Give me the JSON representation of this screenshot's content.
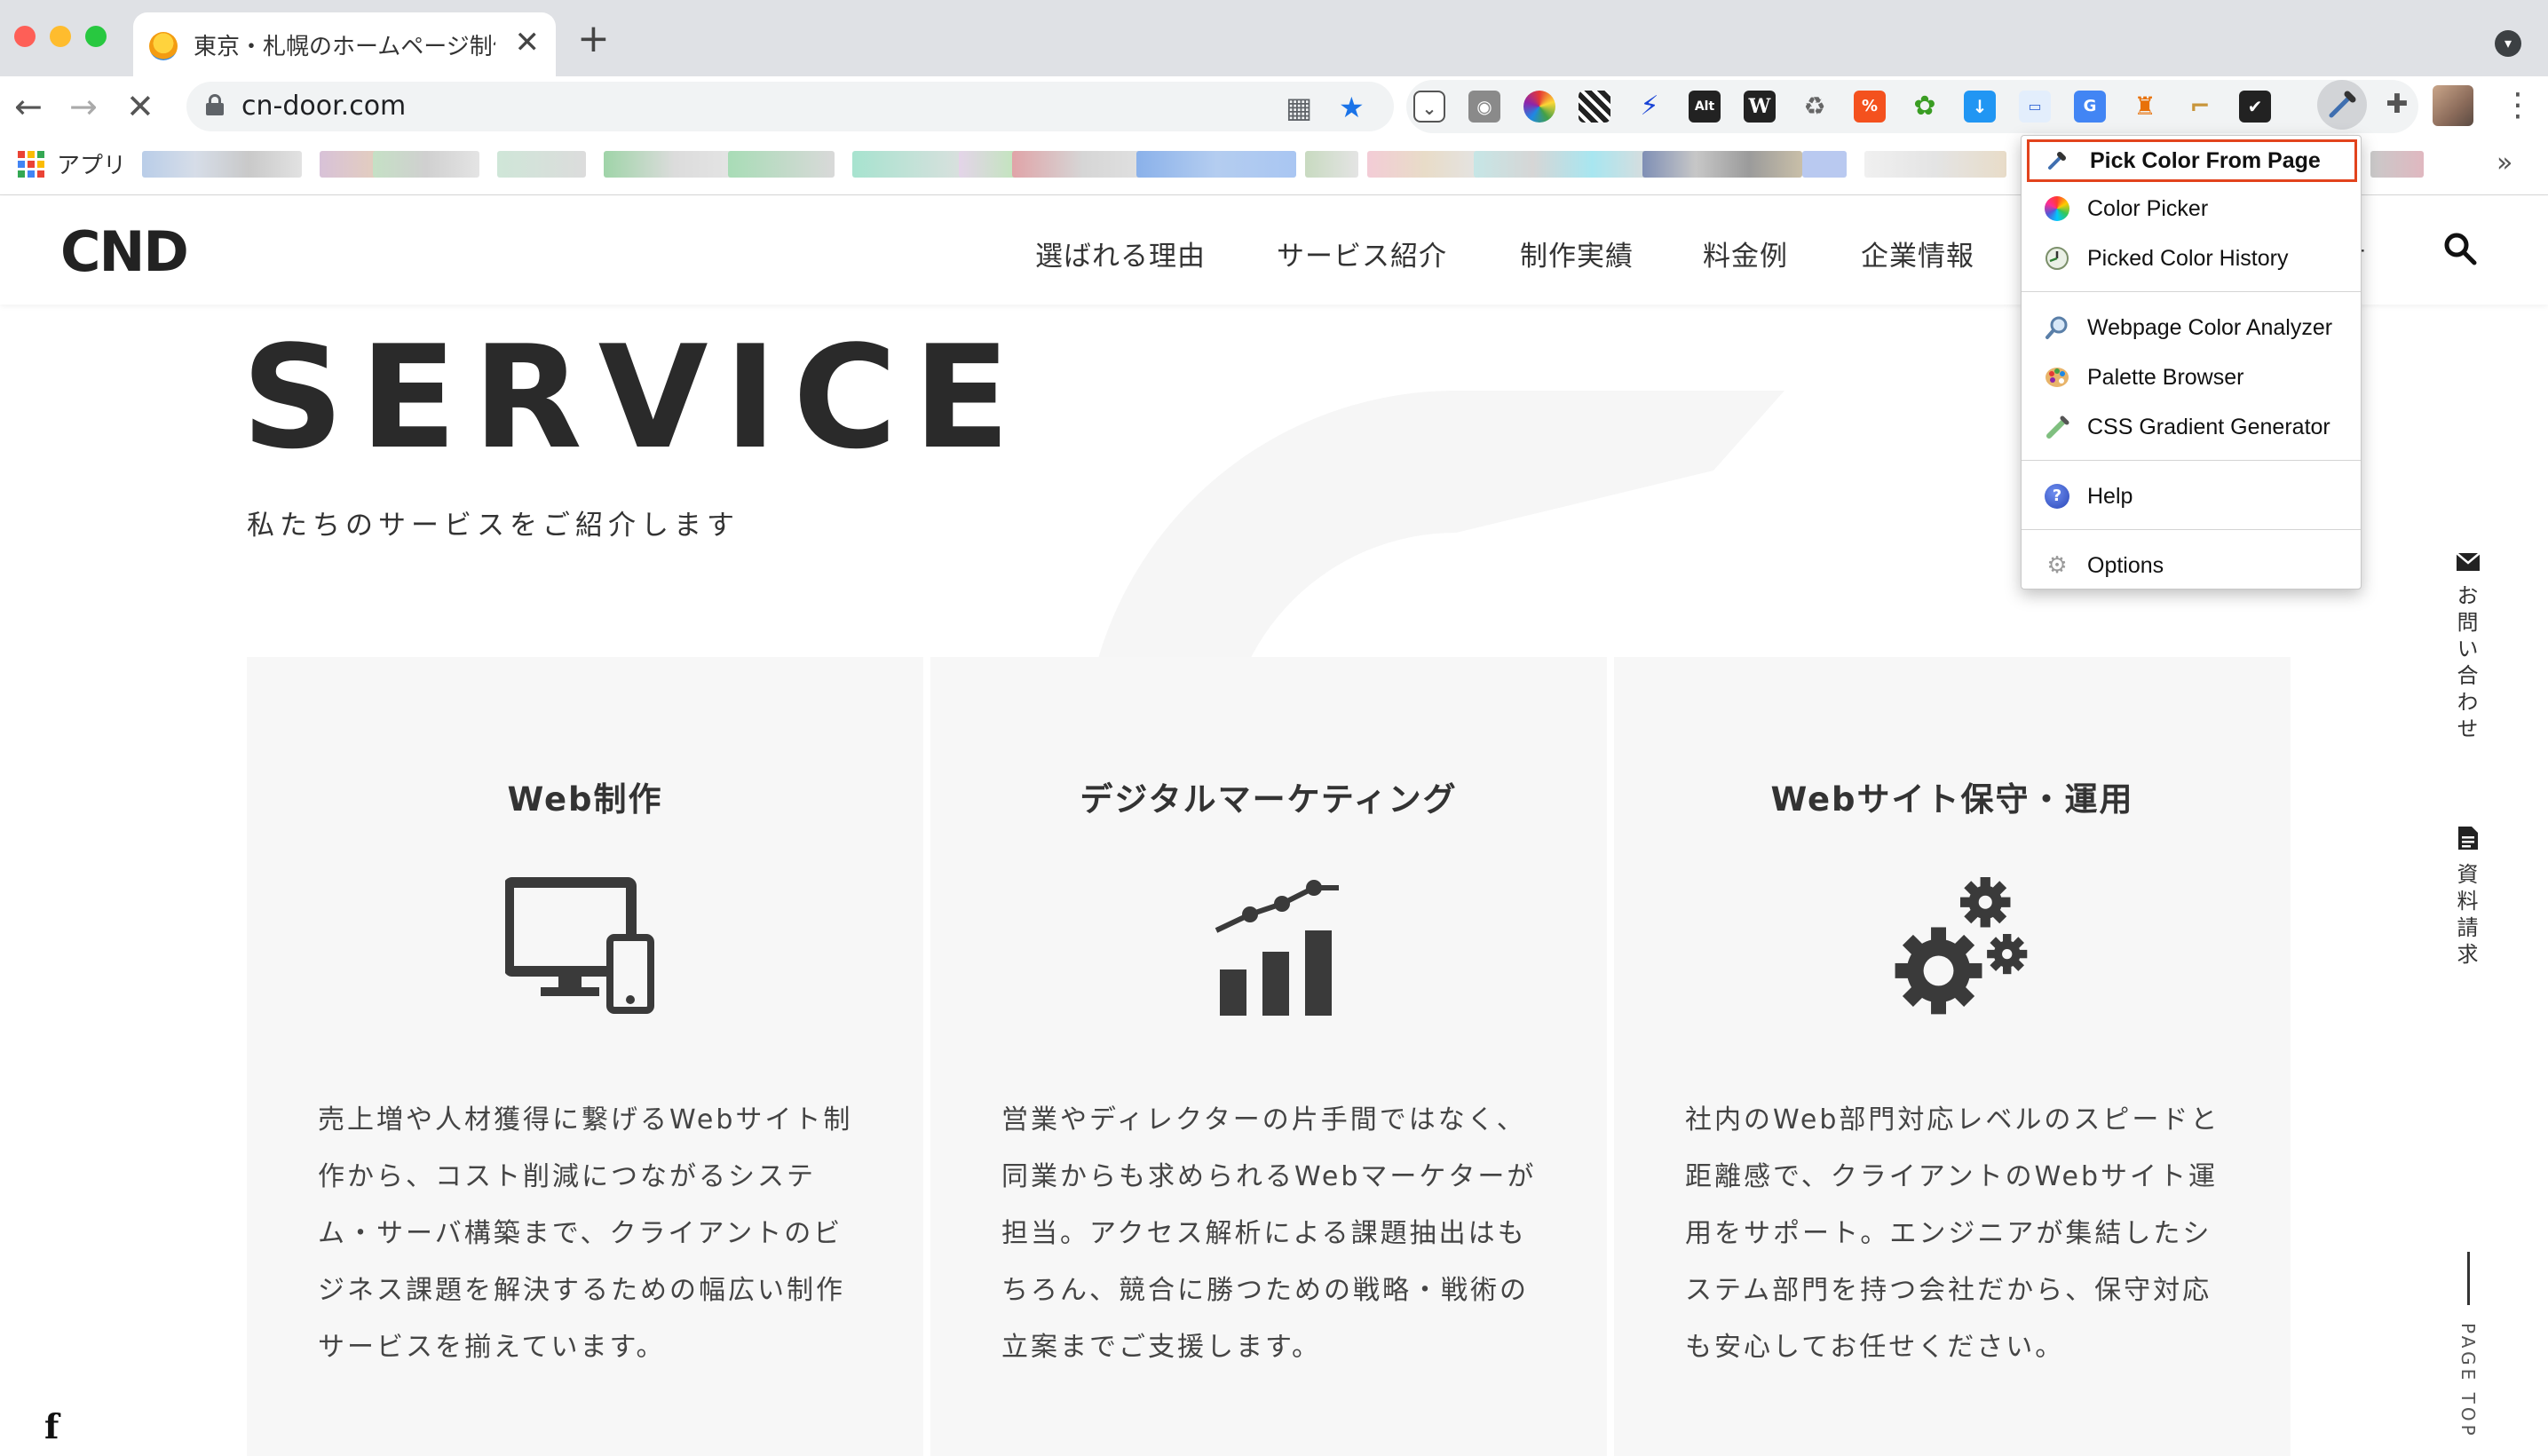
{
  "browser": {
    "tab_title": "東京・札幌のホームページ制作 |",
    "tab_close": "✕",
    "new_tab": "+",
    "url": "cn-door.com",
    "bookmarks_apps_label": "アプリ",
    "bookmarks_more": "»"
  },
  "site": {
    "logo": "CND",
    "nav": [
      "選ばれる理由",
      "サービス紹介",
      "制作実績",
      "料金例",
      "企業情報"
    ],
    "nav_partial": "せ",
    "hero_title": "SERVICE",
    "hero_subtitle": "私たちのサービスをご紹介します",
    "cards": [
      {
        "title": "Web制作",
        "icon": "monitor-phone-icon",
        "lines": [
          "売上増や人材獲得に繋げるWebサイト制",
          "作から、コスト削減につながるシステ",
          "ム・サーバ構築まで、クライアントのビ",
          "ジネス課題を解決するための幅広い制作",
          "サービスを揃えています。"
        ]
      },
      {
        "title": "デジタルマーケティング",
        "icon": "growth-chart-icon",
        "lines": [
          "営業やディレクターの片手間ではなく、",
          "同業からも求められるWebマーケターが",
          "担当。アクセス解析による課題抽出はも",
          "ちろん、競合に勝つための戦略・戦術の",
          "立案までご支援します。"
        ]
      },
      {
        "title": "Webサイト保守・運用",
        "icon": "gears-icon",
        "lines": [
          "社内のWeb部門対応レベルのスピードと",
          "距離感で、クライアントのWebサイト運",
          "用をサポート。エンジニアが集結したシ",
          "ステム部門を持つ会社だから、保守対応",
          "も安心してお任せください。"
        ]
      }
    ],
    "side_contact": "お問い合わせ",
    "side_request": "資料請求",
    "page_top": "PAGE TOP",
    "facebook": "f"
  },
  "extension_menu": {
    "items": [
      {
        "label": "Pick Color From Page",
        "icon": "eyedropper-icon",
        "highlighted": true
      },
      {
        "label": "Color Picker",
        "icon": "color-wheel-icon"
      },
      {
        "label": "Picked Color History",
        "icon": "history-clock-icon"
      },
      {
        "label": "Webpage Color Analyzer",
        "icon": "magnifier-icon"
      },
      {
        "label": "Palette Browser",
        "icon": "palette-icon"
      },
      {
        "label": "CSS Gradient Generator",
        "icon": "gradient-pen-icon"
      },
      {
        "label": "Help",
        "icon": "help-icon"
      },
      {
        "label": "Options",
        "icon": "options-gear-icon"
      }
    ]
  },
  "colors": {
    "accent_highlight": "#e2431d",
    "bookmark_star": "#1a73e8",
    "card_background": "#f7f7f7"
  }
}
